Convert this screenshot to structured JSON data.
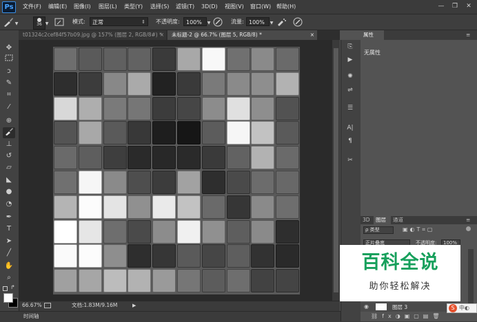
{
  "app": {
    "logo": "Ps"
  },
  "menu": {
    "items": [
      "文件(F)",
      "编辑(E)",
      "图像(I)",
      "图层(L)",
      "类型(Y)",
      "选择(S)",
      "滤镜(T)",
      "3D(D)",
      "视图(V)",
      "窗口(W)",
      "帮助(H)"
    ]
  },
  "window_controls": {
    "minimize": "—",
    "restore": "❐",
    "close": "✕"
  },
  "options": {
    "brush_size": "36",
    "mode_label": "模式:",
    "mode_value": "正常",
    "opacity_label": "不透明度:",
    "opacity_value": "100%",
    "flow_label": "流量:",
    "flow_value": "100%"
  },
  "tabs": [
    {
      "label": "t01324c2cef84f57b09.jpg @ 157% (图层 2, RGB/8#) *",
      "close": "×",
      "active": false
    },
    {
      "label": "未标题-2 @ 66.7% (图层 5, RGB/8) *",
      "close": "×",
      "active": true
    }
  ],
  "canvas": {
    "tile_grays": [
      [
        "#6e6e6e",
        "#5a5a5a",
        "#606060",
        "#626262",
        "#3a3a3a",
        "#a8a8a8",
        "#f8f8f8",
        "#707070",
        "#8a8a8a",
        "#6a6a6a"
      ],
      [
        "#2e2e2e",
        "#3c3c3c",
        "#888888",
        "#aaaaaa",
        "#222222",
        "#3a3a3a",
        "#7a7a7a",
        "#8a8a8a",
        "#8e8e8e",
        "#b2b2b2"
      ],
      [
        "#d8d8d8",
        "#aeaeae",
        "#7a7a7a",
        "#767676",
        "#3c3c3c",
        "#464646",
        "#8c8c8c",
        "#e0e0e0",
        "#8e8e8e",
        "#525252"
      ],
      [
        "#545454",
        "#a8a8a8",
        "#5a5a5a",
        "#383838",
        "#1e1e1e",
        "#161616",
        "#5c5c5c",
        "#f6f6f6",
        "#c2c2c2",
        "#5a5a5a"
      ],
      [
        "#6a6a6a",
        "#5e5e5e",
        "#3e3e3e",
        "#2a2a2a",
        "#282828",
        "#2a2a2a",
        "#3a3a3a",
        "#626262",
        "#b2b2b2",
        "#6a6a6a"
      ],
      [
        "#707070",
        "#f6f6f6",
        "#8a8a8a",
        "#4e4e4e",
        "#3c3c3c",
        "#a2a2a2",
        "#2e2e2e",
        "#4a4a4a",
        "#6c6c6c",
        "#686868"
      ],
      [
        "#b4b4b4",
        "#fcfcfc",
        "#e4e4e4",
        "#909090",
        "#eaeaea",
        "#c2c2c2",
        "#6a6a6a",
        "#363636",
        "#8a8a8a",
        "#6e6e6e"
      ],
      [
        "#ffffff",
        "#e6e6e6",
        "#6e6e6e",
        "#4a4a4a",
        "#8c8c8c",
        "#f0f0f0",
        "#909090",
        "#5e5e5e",
        "#8a8a8a",
        "#2e2e2e"
      ],
      [
        "#fafafa",
        "#fcfcfc",
        "#8e8e8e",
        "#2e2e2e",
        "#363636",
        "#5a5a5a",
        "#464646",
        "#5e5e5e",
        "#323232",
        "#2a2a2a"
      ],
      [
        "#a0a0a0",
        "#a6a6a6",
        "#bcbcbc",
        "#b2b2b2",
        "#9a9a9a",
        "#767676",
        "#5c5c5c",
        "#6e6e6e",
        "#424242",
        "#444444"
      ]
    ]
  },
  "status": {
    "zoom": "66.67%",
    "doc_info": "文档:1.83M/9.16M"
  },
  "timeline": {
    "label": "时间轴"
  },
  "properties_panel": {
    "tab": "属性",
    "empty_text": "无属性"
  },
  "layers_panel": {
    "tabs": [
      "3D",
      "图层",
      "通道"
    ],
    "filter_label": "ρ 类型",
    "blend_mode": "正片叠底",
    "opacity_label": "不透明度:",
    "opacity_value": "100%",
    "layer_name": "图层 3"
  },
  "watermark": {
    "title": "百科全说",
    "subtitle": "助你轻松解决"
  },
  "ime": {
    "label": "S"
  }
}
